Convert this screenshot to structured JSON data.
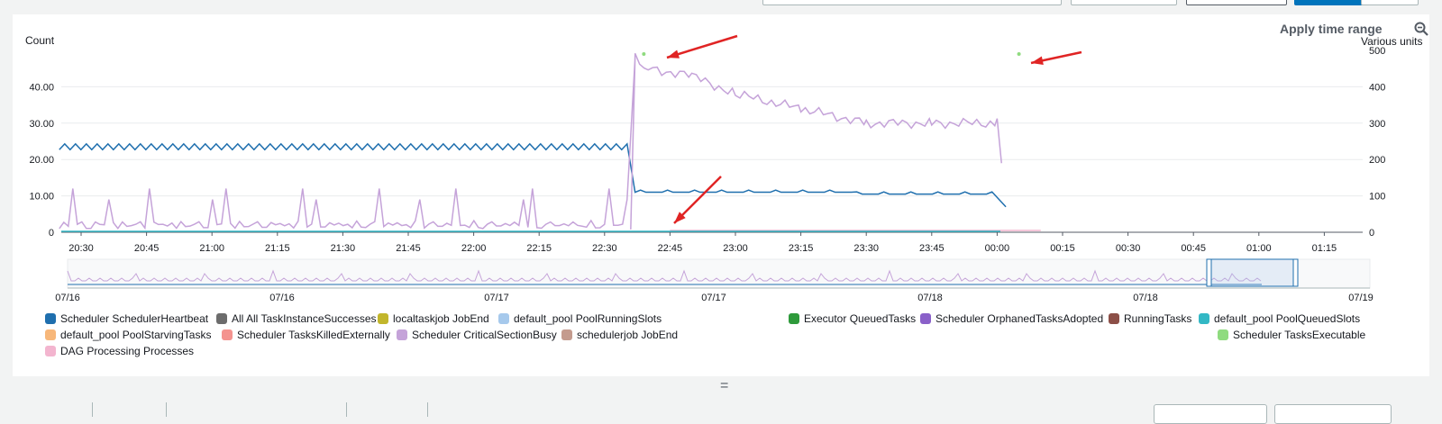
{
  "widget": {
    "left_axis_label": "Count",
    "right_axis_label": "Various units",
    "apply_time_range": "Apply time range",
    "zoom_icon": "zoom-out-icon",
    "drag_handle": "="
  },
  "chart_data": {
    "type": "line",
    "x_ticks": [
      "20:30",
      "20:45",
      "21:00",
      "21:15",
      "21:30",
      "21:45",
      "22:00",
      "22:15",
      "22:30",
      "22:45",
      "23:00",
      "23:15",
      "23:30",
      "23:45",
      "00:00",
      "00:15",
      "00:30",
      "00:45",
      "01:00",
      "01:15"
    ],
    "y_left_ticks": [
      "0",
      "10.00",
      "20.00",
      "30.00",
      "40.00"
    ],
    "y_right_ticks": [
      "0",
      "100",
      "200",
      "300",
      "400",
      "500"
    ],
    "y_left_range": [
      0,
      50
    ],
    "y_right_range": [
      0,
      500
    ],
    "navigator_ticks": [
      "07/16",
      "07/16",
      "07/17",
      "07/17",
      "07/18",
      "07/18",
      "07/19"
    ],
    "series": [
      {
        "name": "Scheduler SchedulerHeartbeat",
        "color": "#1f6fae",
        "axis": "left",
        "x": [
          "20:25",
          "22:36",
          "22:37",
          "00:00",
          "00:02"
        ],
        "values": [
          23.5,
          23.5,
          11,
          10,
          7
        ]
      },
      {
        "name": "Scheduler CriticalSectionBusy",
        "color": "#c5a3d9",
        "axis": "right",
        "x": [
          "20:25",
          "22:36",
          "22:37",
          "22:40",
          "22:50",
          "23:00",
          "23:15",
          "23:30",
          "23:45",
          "00:00",
          "00:01"
        ],
        "values": [
          20,
          20,
          480,
          450,
          430,
          380,
          340,
          300,
          300,
          300,
          190
        ]
      },
      {
        "name": "Scheduler TasksExecutable",
        "color": "#8fdb7f",
        "axis": "right",
        "x": [
          "22:39",
          "00:05"
        ],
        "values": [
          490,
          490
        ]
      },
      {
        "name": "DAG Processing Processes",
        "color": "#f3b5cf",
        "axis": "right",
        "x": [
          "22:45",
          "00:10"
        ],
        "values": [
          5,
          5
        ]
      }
    ]
  },
  "legend": [
    {
      "label": "Scheduler SchedulerHeartbeat",
      "color": "#1f6fae"
    },
    {
      "label": "All All TaskInstanceSuccesses",
      "color": "#6c6c6c"
    },
    {
      "label": "localtaskjob JobEnd",
      "color": "#c2b62c"
    },
    {
      "label": "default_pool PoolRunningSlots",
      "color": "#a6c9ec"
    },
    {
      "label": "Executor QueuedTasks",
      "color": "#2e9a3b"
    },
    {
      "label": "Scheduler OrphanedTasksAdopted",
      "color": "#8a60c9"
    },
    {
      "label": "RunningTasks",
      "color": "#8c4f47"
    },
    {
      "label": "default_pool PoolQueuedSlots",
      "color": "#33b8c5"
    },
    {
      "label": "default_pool PoolStarvingTasks",
      "color": "#f7b77a"
    },
    {
      "label": "Scheduler TasksKilledExternally",
      "color": "#f4938f"
    },
    {
      "label": "Scheduler CriticalSectionBusy",
      "color": "#c5a3d9"
    },
    {
      "label": "schedulerjob JobEnd",
      "color": "#c49b8e"
    },
    {
      "label": "Scheduler TasksExecutable",
      "color": "#8fdb7f"
    },
    {
      "label": "DAG Processing Processes",
      "color": "#f3b5cf"
    }
  ]
}
